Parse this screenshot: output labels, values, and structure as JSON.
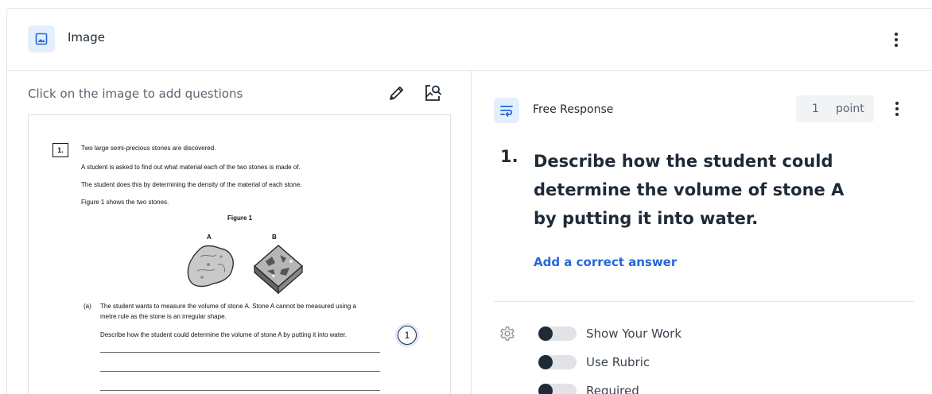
{
  "header": {
    "title": "Image",
    "icon": "image-icon"
  },
  "left": {
    "hint": "Click on the image to add questions",
    "doc": {
      "question_number": "1.",
      "lines": [
        "Two large semi-precious stones are discovered.",
        "A student is asked to find out what material each of the two stones is made of.",
        "The student does this by determining the density of the material of each stone.",
        "Figure 1 shows the two stones."
      ],
      "figure_title": "Figure 1",
      "figure_labels": [
        "A",
        "B"
      ],
      "part_label": "(a)",
      "part_lines": [
        "The student wants to measure the volume of stone A. Stone A cannot be measured using a",
        "metre rule as the stone is an irregular shape.",
        "Describe how the student could determine the volume of stone A by putting it into water."
      ],
      "marker": "1"
    }
  },
  "right": {
    "type_label": "Free Response",
    "points_value": "1",
    "points_unit": "point",
    "question_index": "1.",
    "question_text": "Describe how the student could determine the volume of stone A by putting it into water.",
    "add_answer": "Add a correct answer",
    "toggles": [
      {
        "label": "Show Your Work",
        "on": false
      },
      {
        "label": "Use Rubric",
        "on": false
      },
      {
        "label": "Required",
        "on": false
      }
    ]
  },
  "colors": {
    "accent": "#2567d8",
    "icon_bg": "#e4effd",
    "text": "#1f2a37"
  }
}
